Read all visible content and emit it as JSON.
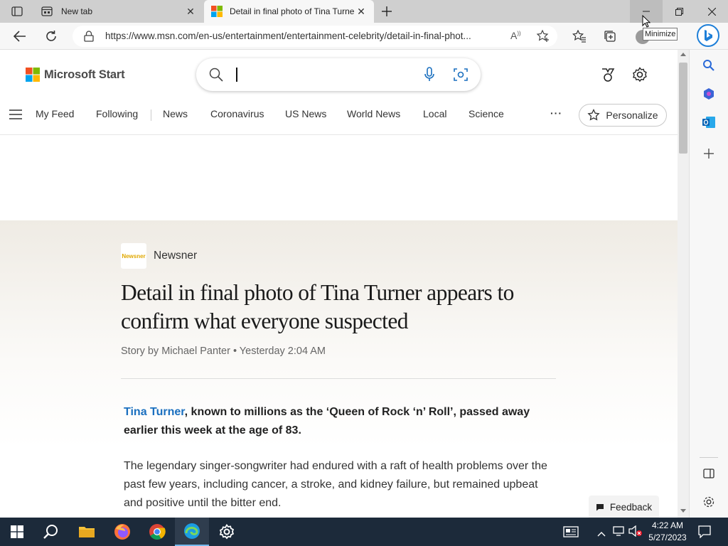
{
  "browser": {
    "tabs": [
      {
        "title": "New tab",
        "active": false
      },
      {
        "title": "Detail in final photo of Tina Turner appears to confirm what everyone suspected",
        "active": true
      }
    ],
    "url": "https://www.msn.com/en-us/entertainment/entertainment-celebrity/detail-in-final-phot...",
    "tooltip": "Minimize"
  },
  "site": {
    "brand": "Microsoft Start",
    "search": {
      "value": "",
      "placeholder": ""
    },
    "nav": [
      "My Feed",
      "Following",
      "News",
      "Coronavirus",
      "US News",
      "World News",
      "Local",
      "Science"
    ],
    "more": "···",
    "personalize_label": "Personalize"
  },
  "article": {
    "publisher_logo_text": "Newsner",
    "publisher": "Newsner",
    "headline": "Detail in final photo of Tina Turner appears to confirm what everyone suspected",
    "byline": "Story by Michael Panter • Yesterday 2:04 AM",
    "lead_link": "Tina Turner",
    "lead_rest": ", known to millions as the ‘Queen of Rock ‘n’ Roll’, passed away earlier this week at the age of 83.",
    "para2": "The legendary singer-songwriter had endured with a raft of health problems over the past few years, including cancer, a stroke, and kidney failure, but remained upbeat and positive until the bitter end."
  },
  "feedback_label": "Feedback",
  "taskbar": {
    "time": "4:22 AM",
    "date": "5/27/2023"
  },
  "colors": {
    "accent": "#1a6fbf",
    "taskbar": "#1c2a3a",
    "ms_red": "#f25022",
    "ms_green": "#7fba00",
    "ms_blue": "#00a4ef",
    "ms_yellow": "#ffb900"
  }
}
